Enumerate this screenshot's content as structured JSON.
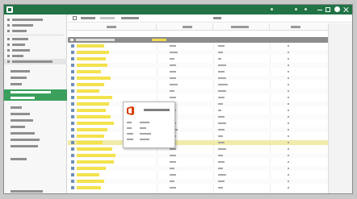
{
  "colors": {
    "titlebar": "#217346",
    "accent": "#3aa05c",
    "highlight_row": "#f1eba9",
    "name_highlight": "#f3e24d",
    "group_row": "#8c8c8c",
    "group_badge": "#f0d84a",
    "office_logo": "#d83b01"
  },
  "window": {
    "title": ""
  },
  "breadcrumb": {
    "path": [
      "",
      "",
      ""
    ]
  },
  "table": {
    "headers": [
      "",
      "",
      "",
      ""
    ]
  },
  "popup": {
    "title": "",
    "lines": [
      "",
      "",
      "",
      ""
    ]
  },
  "icons": {
    "app": "spreadsheet-app-icon",
    "office": "office-logo-icon",
    "row": "document-icon",
    "nav": "list-icon"
  }
}
